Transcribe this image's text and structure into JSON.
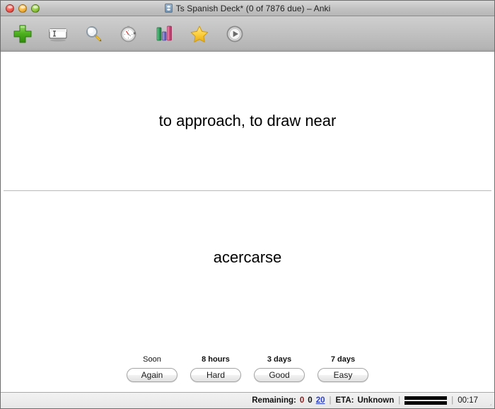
{
  "window": {
    "title": "Ts Spanish Deck* (0 of 7876 due) – Anki",
    "title_icon": "anki-deck-icon",
    "controls": {
      "close": "close-button",
      "minimize": "minimize-button",
      "maximize": "maximize-button"
    }
  },
  "toolbar": {
    "items": [
      {
        "name": "add-icon",
        "label": "Add"
      },
      {
        "name": "edit-icon",
        "label": "Edit"
      },
      {
        "name": "browse-icon",
        "label": "Browse"
      },
      {
        "name": "stopwatch-icon",
        "label": "Timer"
      },
      {
        "name": "stats-icon",
        "label": "Statistics"
      },
      {
        "name": "star-icon",
        "label": "Mark"
      },
      {
        "name": "play-icon",
        "label": "Replay Audio"
      }
    ]
  },
  "card": {
    "question": "to approach, to draw near",
    "answer": "acercarse"
  },
  "ease_buttons": [
    {
      "interval": "Soon",
      "label": "Again",
      "bold_interval": false
    },
    {
      "interval": "8 hours",
      "label": "Hard",
      "bold_interval": true
    },
    {
      "interval": "3 days",
      "label": "Good",
      "bold_interval": true
    },
    {
      "interval": "7 days",
      "label": "Easy",
      "bold_interval": true
    }
  ],
  "status": {
    "remaining_label": "Remaining:",
    "count_new": "0",
    "count_learning": "0",
    "count_due": "20",
    "separator": "|",
    "eta_label": "ETA:",
    "eta_value": "Unknown",
    "clock": "00:17",
    "progress_bars": 2
  },
  "colors": {
    "count_new": "#8b1a1a",
    "count_learning": "#111111",
    "count_due": "#2b3fd0",
    "toolbar_bg": "#c2c2c2",
    "statusbar_bg": "#ebebeb",
    "card_bg": "#ffffff"
  }
}
